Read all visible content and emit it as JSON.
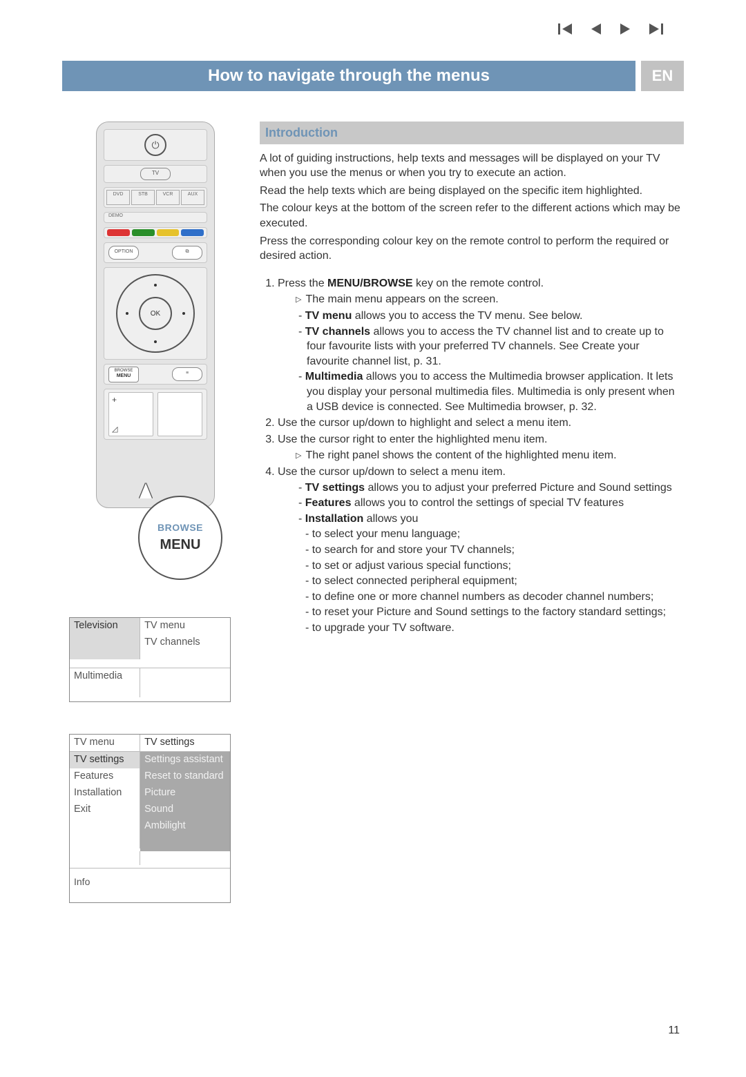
{
  "header": {
    "title": "How to navigate through the menus",
    "lang_badge": "EN"
  },
  "nav_icons": [
    "skip-prev",
    "prev",
    "next",
    "skip-next"
  ],
  "remote": {
    "power": "⏻",
    "tv_button": "TV",
    "mode_buttons": [
      "DVD",
      "STB",
      "VCR",
      "AUX"
    ],
    "demo_label": "DEMO",
    "option_label": "OPTION",
    "pip_icon": "⧉",
    "ok_label": "OK",
    "browse_label": "BROWSE",
    "menu_label": "MENU",
    "teletext_icon": "≡"
  },
  "callout": {
    "browse": "BROWSE",
    "menu": "MENU"
  },
  "menu_panel_1": {
    "left_selected": "Television",
    "right_items": [
      "TV menu",
      "TV channels"
    ],
    "left_bottom": "Multimedia"
  },
  "menu_panel_2": {
    "left_header": "TV menu",
    "right_header": "TV settings",
    "left_items": [
      "TV settings",
      "Features",
      "Installation",
      "Exit"
    ],
    "left_selected_index": 0,
    "right_items": [
      "Settings assistant",
      "Reset to standard",
      "Picture",
      "Sound",
      "Ambilight"
    ],
    "info_label": "Info"
  },
  "intro": {
    "heading": "Introduction",
    "p1": "A lot of guiding instructions, help texts and messages will be displayed on your TV when you use the menus or when you try to execute an action.",
    "p2": "Read the help texts which are being displayed on the specific item highlighted.",
    "p3": "The colour keys at the bottom of the screen refer to the different actions which may be executed.",
    "p4": "Press the corresponding colour key on the remote control to perform the required or desired action."
  },
  "steps": {
    "s1": "Press the ",
    "s1_bold": "MENU/BROWSE",
    "s1_tail": " key on the remote control.",
    "s1a": "The main menu appears on the screen.",
    "s1b_bold": "TV menu",
    "s1b_tail": " allows you to access the TV menu. See below.",
    "s1c_bold": "TV channels",
    "s1c_tail": " allows you to access the TV channel list and to create up to four favourite lists with your preferred TV channels. See Create your favourite channel list, p. 31.",
    "s1d_bold": "Multimedia",
    "s1d_tail": " allows you to access the Multimedia browser application. It lets you display your personal multimedia files. Multimedia is only present when a USB device is connected. See Multimedia browser, p. 32.",
    "s2": "Use the cursor up/down to highlight and select a menu item.",
    "s3": "Use the cursor right to enter the highlighted menu item.",
    "s3a": "The right panel shows the content of the highlighted menu item.",
    "s4": "Use the cursor up/down to select a menu item.",
    "s4a_bold": "TV settings",
    "s4a_tail": " allows you to adjust your preferred Picture and Sound settings",
    "s4b_bold": "Features",
    "s4b_tail": " allows you to control the settings of special TV features",
    "s4c_bold": "Installation",
    "s4c_tail": " allows you",
    "s4c_items": [
      "to select your menu language;",
      "to search for and store your TV channels;",
      "to set or adjust various special functions;",
      "to select connected peripheral equipment;",
      "to define one or more channel numbers as decoder channel numbers;",
      "to reset your Picture and Sound settings to the factory standard settings;",
      "to upgrade your TV software."
    ]
  },
  "page_number": "11"
}
